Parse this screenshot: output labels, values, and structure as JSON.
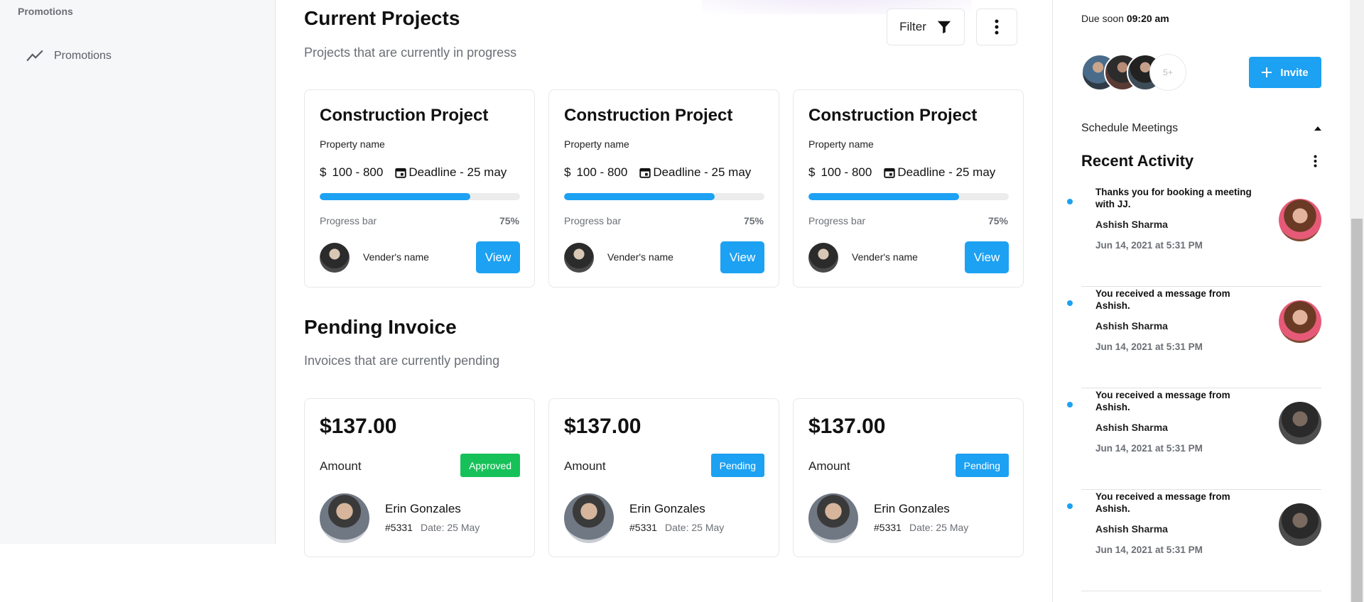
{
  "sidebar": {
    "section_title": "Promotions",
    "items": [
      {
        "label": "Promotions",
        "icon": "trend-line-icon"
      }
    ]
  },
  "current_projects": {
    "title": "Current Projects",
    "subtitle": "Projects that are currently in progress",
    "filter_label": "Filter",
    "cards": [
      {
        "title": "Construction Project",
        "property": "Property name",
        "currency": "$",
        "price": "100 - 800",
        "deadline": "Deadline - 25 may",
        "progress_label": "Progress bar",
        "progress_text": "75%",
        "progress_value": 0.75,
        "vendor": "Vender's name",
        "view_label": "View"
      },
      {
        "title": "Construction Project",
        "property": "Property name",
        "currency": "$",
        "price": "100 - 800",
        "deadline": "Deadline - 25 may",
        "progress_label": "Progress bar",
        "progress_text": "75%",
        "progress_value": 0.75,
        "vendor": "Vender's name",
        "view_label": "View"
      },
      {
        "title": "Construction Project",
        "property": "Property name",
        "currency": "$",
        "price": "100 - 800",
        "deadline": "Deadline - 25 may",
        "progress_label": "Progress bar",
        "progress_text": "75%",
        "progress_value": 0.75,
        "vendor": "Vender's name",
        "view_label": "View"
      }
    ]
  },
  "pending_invoice": {
    "title": "Pending Invoice",
    "subtitle": "Invoices that are currently pending",
    "cards": [
      {
        "amount": "$137.00",
        "amount_label": "Amount",
        "status": "Approved",
        "status_color": "#17c15a",
        "name": "Erin Gonzales",
        "number": "#5331",
        "date": "Date: 25 May"
      },
      {
        "amount": "$137.00",
        "amount_label": "Amount",
        "status": "Pending",
        "status_color": "#1da1f2",
        "name": "Erin Gonzales",
        "number": "#5331",
        "date": "Date: 25 May"
      },
      {
        "amount": "$137.00",
        "amount_label": "Amount",
        "status": "Pending",
        "status_color": "#1da1f2",
        "name": "Erin Gonzales",
        "number": "#5331",
        "date": "Date: 25 May"
      }
    ]
  },
  "right_panel": {
    "due_prefix": "Due soon",
    "due_time": "09:20 am",
    "avatars_more": "5+",
    "invite_label": "Invite",
    "schedule_label": "Schedule Meetings",
    "recent_title": "Recent Activity",
    "activities": [
      {
        "message": "Thanks you for booking a meeting with JJ.",
        "name": "Ashish Sharma",
        "time": "Jun 14, 2021 at 5:31 PM",
        "avatar": "woman-avatar"
      },
      {
        "message": "You received a message from Ashish.",
        "name": "Ashish Sharma",
        "time": "Jun 14, 2021 at 5:31 PM",
        "avatar": "woman-avatar"
      },
      {
        "message": "You received a message from Ashish.",
        "name": "Ashish Sharma",
        "time": "Jun 14, 2021 at 5:31 PM",
        "avatar": "man-avatar"
      },
      {
        "message": "You received a message from Ashish.",
        "name": "Ashish Sharma",
        "time": "Jun 14, 2021 at 5:31 PM",
        "avatar": "man-avatar"
      }
    ]
  },
  "colors": {
    "accent": "#1da1f2",
    "approved": "#17c15a",
    "muted_text": "#6b6f75"
  }
}
